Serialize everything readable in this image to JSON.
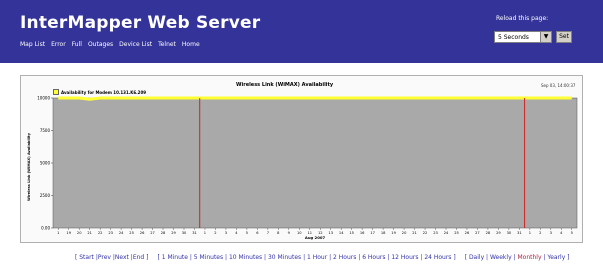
{
  "header": {
    "title": "InterMapper Web Server",
    "nav": [
      "Map List",
      "Error",
      "Full",
      "Outages",
      "Device List",
      "Telnet",
      "Home"
    ],
    "reload_label": "Reload this page:",
    "reload_value": "5 Seconds",
    "set_label": "Set"
  },
  "colors": {
    "header_bg": "#33339a",
    "plot_bg": "#a9a9a9",
    "series_line": "#ffff33",
    "marker_line": "#cc2222",
    "link": "#3333aa",
    "link_active": "#aa2244"
  },
  "chart_data": {
    "type": "area",
    "title": "Wireless Link (WiMAX) Availability",
    "date_stamp": "Sep 03, 14:00:37",
    "ylabel": "Wireless Link (WiMAX) Availability",
    "xlabel": "Aug 2007",
    "ylim": [
      0,
      10000
    ],
    "yticks": [
      "0.00",
      "2500",
      "5000",
      "7500",
      "10000"
    ],
    "xticks": [
      "1",
      "19",
      "20",
      "21",
      "22",
      "23",
      "24",
      "25",
      "26",
      "27",
      "28",
      "29",
      "30",
      "31",
      "1",
      "2",
      "3",
      "4",
      "5",
      "6",
      "7",
      "8",
      "9",
      "10",
      "11",
      "12",
      "13",
      "14",
      "15",
      "16",
      "17",
      "18",
      "19",
      "20",
      "21",
      "22",
      "23",
      "24",
      "25",
      "26",
      "27",
      "28",
      "29",
      "30",
      "31",
      "1",
      "2",
      "3",
      "4",
      "5"
    ],
    "series": [
      {
        "name": "Availability for Modem 10.131.K6.209",
        "values": [
          10000,
          10000,
          10000,
          9900,
          10000,
          10000,
          10000,
          10000,
          10000,
          10000,
          10000,
          10000,
          10000,
          10000,
          10000,
          10000,
          10000,
          10000,
          10000,
          10000,
          10000,
          10000,
          10000,
          10000,
          10000,
          10000,
          10000,
          10000,
          10000,
          10000,
          10000,
          10000,
          10000,
          10000,
          10000,
          10000,
          10000,
          10000,
          10000,
          10000,
          10000,
          10000,
          10000,
          10000,
          10000,
          10000,
          10000,
          10000,
          10000,
          10000
        ]
      }
    ],
    "month_markers": [
      14,
      45
    ],
    "grid": false,
    "legend_position": "top-left"
  },
  "time_links": {
    "nav": [
      "Start",
      "Prev",
      "Next",
      "End"
    ],
    "ranges": [
      "1 Minute",
      "5 Minutes",
      "10 Minutes",
      "30 Minutes",
      "1 Hour",
      "2 Hours",
      "6 Hours",
      "12 Hours",
      "24 Hours"
    ],
    "periods": [
      "Daily",
      "Weekly",
      "Monthly",
      "Yearly"
    ],
    "active_period": "Monthly"
  }
}
